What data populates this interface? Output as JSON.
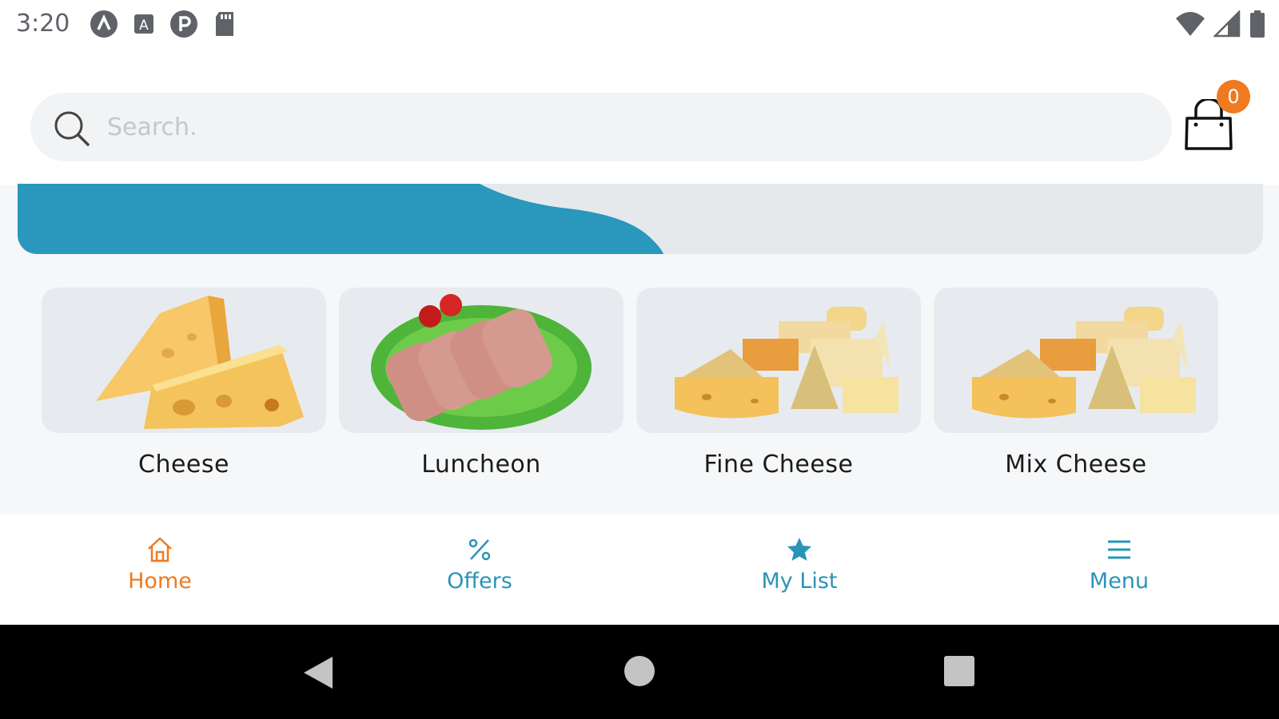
{
  "status_bar": {
    "time": "3:20",
    "left_icons": [
      "app-a-icon",
      "keyboard-a-icon",
      "app-p-icon",
      "sd-card-icon"
    ],
    "right_icons": [
      "wifi-icon",
      "signal-icon",
      "battery-icon"
    ]
  },
  "header": {
    "search_placeholder": "Search.",
    "cart_count": "0"
  },
  "categories": [
    {
      "label": "Cheese",
      "icon": "cheese-image"
    },
    {
      "label": "Luncheon",
      "icon": "luncheon-image"
    },
    {
      "label": "Fine Cheese",
      "icon": "fine-cheese-image"
    },
    {
      "label": "Mix Cheese",
      "icon": "mix-cheese-image"
    }
  ],
  "bottom_nav": {
    "home": "Home",
    "offers": "Offers",
    "my_list": "My List",
    "menu": "Menu"
  },
  "colors": {
    "accent_orange": "#ef7a1f",
    "accent_blue": "#2c93b8",
    "banner_blue": "#2a97bd"
  }
}
